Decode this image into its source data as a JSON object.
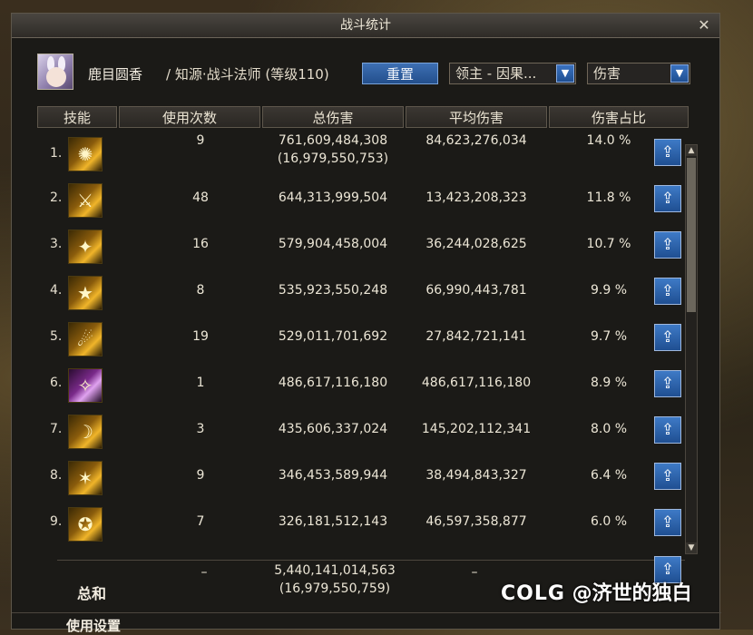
{
  "window": {
    "title": "战斗统计"
  },
  "header": {
    "player_name": "鹿目圆香",
    "player_class": "/ 知源·战斗法师 (等级110)",
    "reset_label": "重置",
    "target_dropdown": "领主 - 因果...",
    "metric_dropdown": "伤害"
  },
  "columns": [
    "技能",
    "使用次数",
    "总伤害",
    "平均伤害",
    "伤害占比"
  ],
  "rows": [
    {
      "index": "1.",
      "uses": "9",
      "total": "761,609,484,308",
      "total_sub": "(16,979,550,753)",
      "avg": "84,623,276,034",
      "pct": "14.0 %"
    },
    {
      "index": "2.",
      "uses": "48",
      "total": "644,313,999,504",
      "avg": "13,423,208,323",
      "pct": "11.8 %"
    },
    {
      "index": "3.",
      "uses": "16",
      "total": "579,904,458,004",
      "avg": "36,244,028,625",
      "pct": "10.7 %"
    },
    {
      "index": "4.",
      "uses": "8",
      "total": "535,923,550,248",
      "avg": "66,990,443,781",
      "pct": "9.9 %"
    },
    {
      "index": "5.",
      "uses": "19",
      "total": "529,011,701,692",
      "avg": "27,842,721,141",
      "pct": "9.7 %"
    },
    {
      "index": "6.",
      "uses": "1",
      "total": "486,617,116,180",
      "avg": "486,617,116,180",
      "pct": "8.9 %"
    },
    {
      "index": "7.",
      "uses": "3",
      "total": "435,606,337,024",
      "avg": "145,202,112,341",
      "pct": "8.0 %"
    },
    {
      "index": "8.",
      "uses": "9",
      "total": "346,453,589,944",
      "avg": "38,494,843,327",
      "pct": "6.4 %"
    },
    {
      "index": "9.",
      "uses": "7",
      "total": "326,181,512,143",
      "avg": "46,597,358,877",
      "pct": "6.0 %"
    }
  ],
  "total": {
    "label": "总和",
    "uses": "–",
    "total": "5,440,141,014,563",
    "total_sub": "(16,979,550,759)",
    "avg": "–"
  },
  "footer": {
    "settings_label": "使用设置"
  },
  "watermark": {
    "brand": "COLG",
    "text": "@济世的独白"
  },
  "colors": {
    "accent_blue": "#2a5fa8",
    "panel": "#1b1a17"
  }
}
